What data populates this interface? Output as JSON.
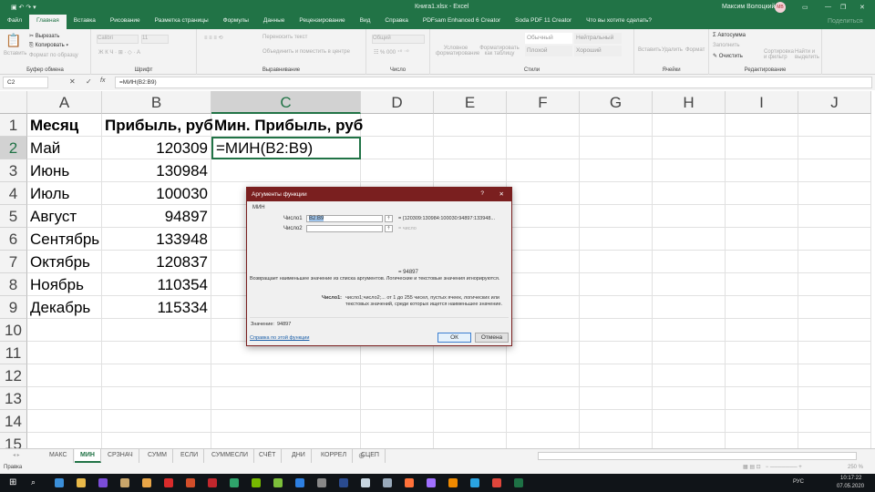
{
  "window": {
    "title": "Книга1.xlsx - Excel",
    "user": "Максим Волоцкий",
    "user_initials": "МВ",
    "share": "Поделиться"
  },
  "ribbon_tabs": [
    "Файл",
    "Главная",
    "Вставка",
    "Рисование",
    "Разметка страницы",
    "Формулы",
    "Данные",
    "Рецензирование",
    "Вид",
    "Справка",
    "PDFsam Enhanced 6 Creator",
    "Soda PDF 11 Creator",
    "Что вы хотите сделать?"
  ],
  "ribbon": {
    "clipboard": {
      "label": "Буфер обмена",
      "paste": "Вставить",
      "cut": "Вырезать",
      "copy": "Копировать",
      "format_painter": "Формат по образцу"
    },
    "font": {
      "label": "Шрифт",
      "name": "Calibri",
      "size": "11"
    },
    "alignment": {
      "label": "Выравнивание",
      "wrap": "Переносить текст",
      "merge": "Объединить и поместить в центре"
    },
    "number": {
      "label": "Число",
      "format": "Общий"
    },
    "styles": {
      "label": "Стили",
      "conditional": "Условное форматирование",
      "as_table": "Форматировать как таблицу",
      "normal": "Обычный",
      "neutral": "Нейтральный",
      "bad": "Плохой",
      "good": "Хороший"
    },
    "cells": {
      "label": "Ячейки",
      "insert": "Вставить",
      "delete": "Удалить",
      "format": "Формат"
    },
    "editing": {
      "label": "Редактирование",
      "autosum": "Автосумма",
      "fill": "Заполнить",
      "clear": "Очистить",
      "sort": "Сортировка и фильтр",
      "find": "Найти и выделить"
    }
  },
  "formula_bar": {
    "name_box": "C2",
    "formula": "=МИН(B2:B9)"
  },
  "columns": [
    "A",
    "B",
    "C",
    "D",
    "E",
    "F",
    "G",
    "H",
    "I",
    "J"
  ],
  "rows": [
    "1",
    "2",
    "3",
    "4",
    "5",
    "6",
    "7",
    "8",
    "9",
    "10",
    "11",
    "12",
    "13",
    "14",
    "15"
  ],
  "cells": {
    "headers": [
      "Месяц",
      "Прибыль, руб",
      "Мин. Прибыль, руб"
    ],
    "data": [
      [
        "Май",
        "120309",
        "=МИН(B2:B9)"
      ],
      [
        "Июнь",
        "130984",
        ""
      ],
      [
        "Июль",
        "100030",
        ""
      ],
      [
        "Август",
        "94897",
        ""
      ],
      [
        "Сентябрь",
        "133948",
        ""
      ],
      [
        "Октябрь",
        "120837",
        ""
      ],
      [
        "Ноябрь",
        "110354",
        ""
      ],
      [
        "Декабрь",
        "115334",
        ""
      ]
    ]
  },
  "dialog": {
    "title": "Аргументы функции",
    "help_q": "?",
    "function": "МИН",
    "arg1_label": "Число1",
    "arg1_value": "B2:B9",
    "arg1_result": "{120309:130984:100030:94897:133948...",
    "arg2_label": "Число2",
    "arg2_hint": "число",
    "result": "= 94897",
    "description": "Возвращает наименьшее значение из списка аргументов. Логические и текстовые значения игнорируются.",
    "arg_help_label": "Число1:",
    "arg_help": "число1;число2;... от 1 до 255 чисел, пустых ячеек, логических или текстовых значений, среди которых ищется наименьшее значение.",
    "value_label": "Значение:",
    "value": "94897",
    "help_link": "Справка по этой функции",
    "ok": "ОК",
    "cancel": "Отмена"
  },
  "sheet_tabs": [
    "МАКС",
    "МИН",
    "СРЗНАЧ",
    "СУММ",
    "ЕСЛИ",
    "СУММЕСЛИ",
    "СЧЁТ",
    "ДНИ",
    "КОРРЕЛ",
    "СЦЕП"
  ],
  "active_sheet": "МИН",
  "status": {
    "mode": "Правка",
    "zoom": "250 %"
  },
  "taskbar": {
    "lang": "РУС",
    "time": "10:17:22",
    "date": "07.05.2020"
  },
  "colors": {
    "excel_green": "#217346",
    "dialog_title": "#7a1f1f",
    "taskbar": "#101418"
  }
}
